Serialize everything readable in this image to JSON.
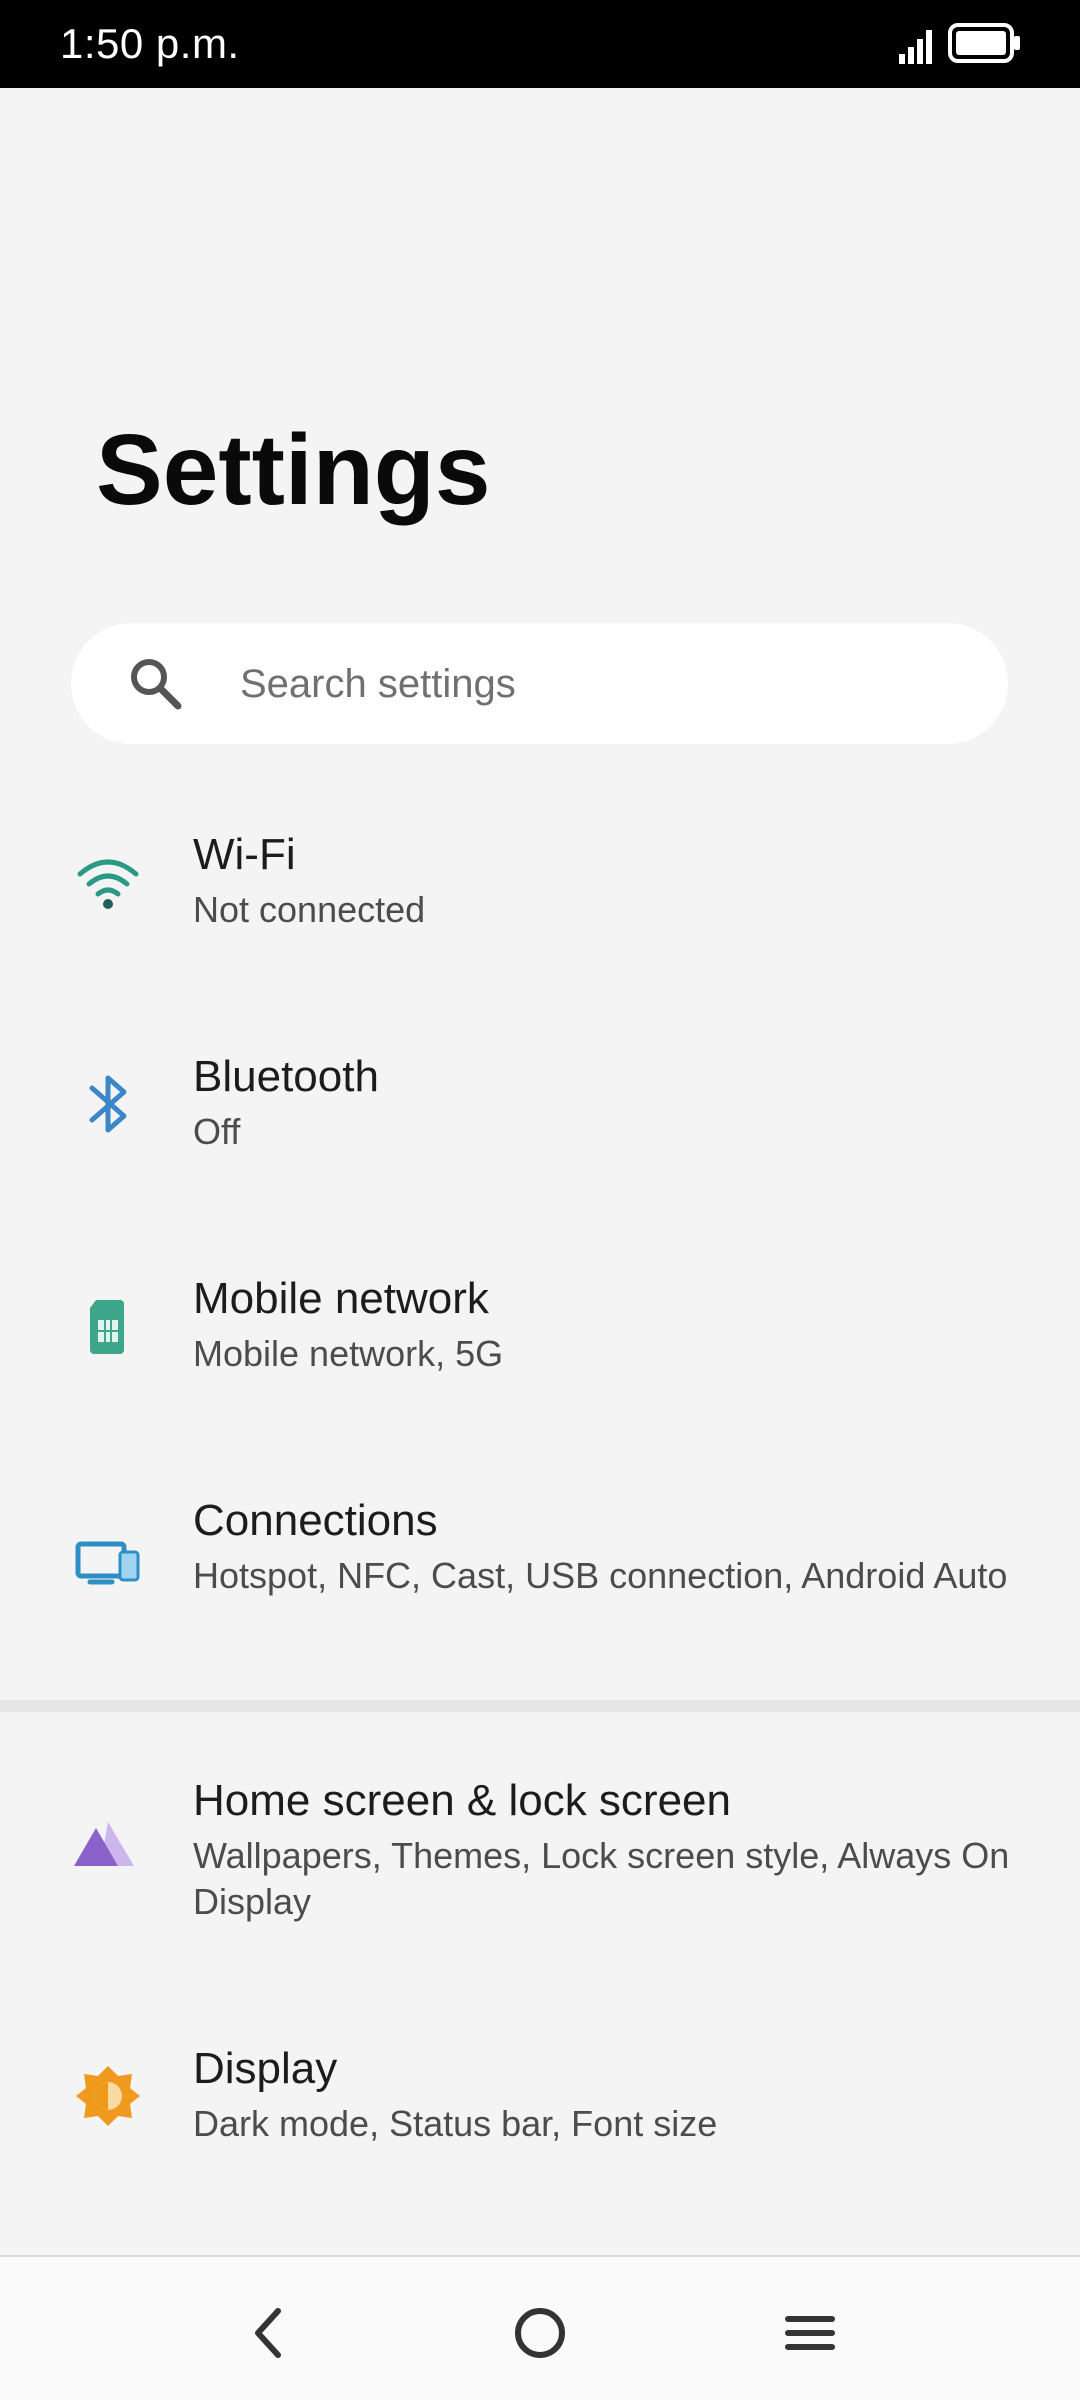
{
  "status_bar": {
    "time": "1:50 p.m.",
    "signal_icon": "signal-strength-icon",
    "battery_icon": "battery-icon"
  },
  "page": {
    "title": "Settings"
  },
  "search": {
    "placeholder": "Search settings",
    "icon": "search-icon"
  },
  "items": [
    {
      "id": "wifi",
      "title": "Wi-Fi",
      "subtitle": "Not connected",
      "icon": "wifi-icon",
      "color": "#2b9a85"
    },
    {
      "id": "bluetooth",
      "title": "Bluetooth",
      "subtitle": "Off",
      "icon": "bluetooth-icon",
      "color": "#3a86c8"
    },
    {
      "id": "mobile-network",
      "title": "Mobile network",
      "subtitle": "Mobile network, 5G",
      "icon": "sim-card-icon",
      "color": "#3ca58a"
    },
    {
      "id": "connections",
      "title": "Connections",
      "subtitle": "Hotspot, NFC, Cast, USB connection, Android Auto",
      "icon": "devices-icon",
      "color": "#2f8fc4"
    },
    {
      "id": "home-lock-screen",
      "title": "Home screen & lock screen",
      "subtitle": "Wallpapers, Themes, Lock screen style, Always On Display",
      "icon": "wallpaper-icon",
      "color": "#8b62c9"
    },
    {
      "id": "display",
      "title": "Display",
      "subtitle": "Dark mode, Status bar, Font size",
      "icon": "brightness-icon",
      "color": "#ef9a1c"
    }
  ],
  "nav": {
    "back_icon": "back-icon",
    "home_icon": "home-icon",
    "menu_icon": "menu-icon"
  }
}
